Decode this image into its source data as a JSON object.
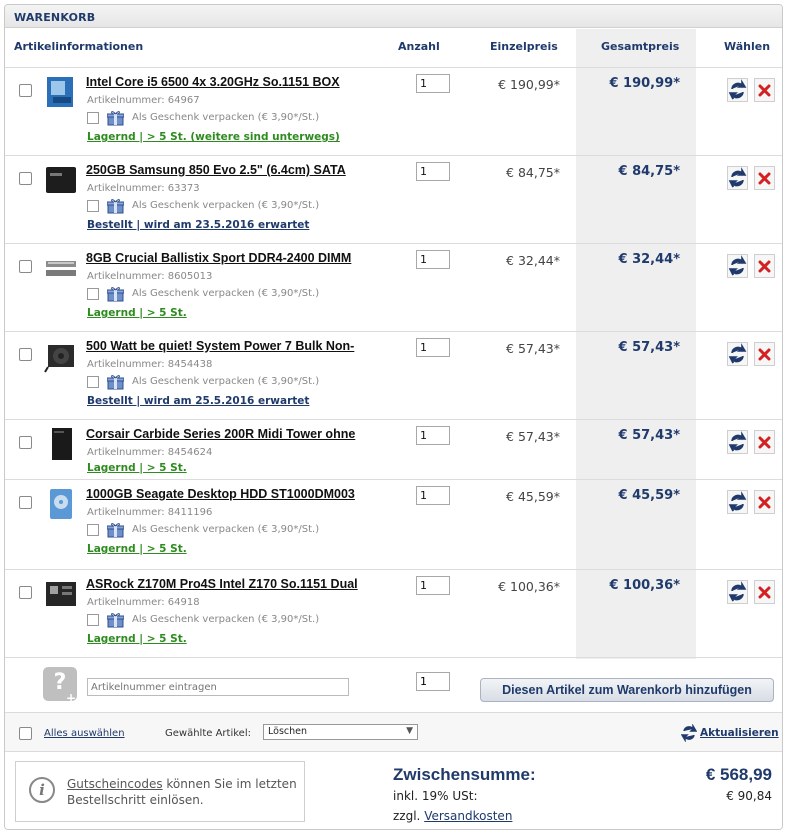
{
  "header": {
    "title": "WARENKORB"
  },
  "columns": {
    "info": "Artikelinformationen",
    "qty": "Anzahl",
    "unit": "Einzelpreis",
    "total": "Gesamtpreis",
    "select": "Wählen"
  },
  "gift_label": "Als Geschenk verpacken (€ 3,90*/St.)",
  "items": [
    {
      "title": "Intel Core i5 6500 4x 3.20GHz So.1151 BOX",
      "artnr": "Artikelnummer: 64967",
      "availability": "Lagernd | > 5 St. (weitere sind unterwegs)",
      "qty": "1",
      "unit_price": "€ 190,99*",
      "total_price": "€ 190,99*"
    },
    {
      "title": "250GB Samsung 850 Evo 2.5\" (6.4cm) SATA",
      "artnr": "Artikelnummer: 63373",
      "availability": "Bestellt | wird am 23.5.2016 erwartet",
      "qty": "1",
      "unit_price": "€ 84,75*",
      "total_price": "€ 84,75*"
    },
    {
      "title": "8GB Crucial Ballistix Sport DDR4-2400 DIMM",
      "artnr": "Artikelnummer: 8605013",
      "availability": "Lagernd | > 5 St.",
      "qty": "1",
      "unit_price": "€ 32,44*",
      "total_price": "€ 32,44*"
    },
    {
      "title": "500 Watt be quiet! System Power 7 Bulk Non-",
      "artnr": "Artikelnummer: 8454438",
      "availability": "Bestellt | wird am 25.5.2016 erwartet",
      "qty": "1",
      "unit_price": "€ 57,43*",
      "total_price": "€ 57,43*"
    },
    {
      "title": "Corsair Carbide Series 200R Midi Tower ohne",
      "artnr": "Artikelnummer: 8454624",
      "availability": "Lagernd | > 5 St.",
      "qty": "1",
      "unit_price": "€ 57,43*",
      "total_price": "€ 57,43*"
    },
    {
      "title": "1000GB Seagate Desktop HDD ST1000DM003",
      "artnr": "Artikelnummer: 8411196",
      "availability": "Lagernd | > 5 St.",
      "qty": "1",
      "unit_price": "€ 45,59*",
      "total_price": "€ 45,59*"
    },
    {
      "title": "ASRock Z170M Pro4S Intel Z170 So.1151 Dual",
      "artnr": "Artikelnummer: 64918",
      "availability": "Lagernd | > 5 St.",
      "qty": "1",
      "unit_price": "€ 100,36*",
      "total_price": "€ 100,36*"
    }
  ],
  "add_item": {
    "placeholder": "Artikelnummer eintragen",
    "qty": "1",
    "button": "Diesen Artikel zum Warenkorb hinzufügen"
  },
  "bulk": {
    "select_all": "Alles auswählen",
    "selected_label": "Gewählte Artikel:",
    "action": "Löschen",
    "refresh": "Aktualisieren"
  },
  "coupon": {
    "link": "Gutscheincodes",
    "text": " können Sie im letzten Bestellschritt einlösen."
  },
  "totals": {
    "subtotal_label": "Zwischensumme:",
    "subtotal": "€ 568,99",
    "vat_label": "inkl. 19% USt:",
    "vat": "€ 90,84",
    "shipping_prefix": "zzgl. ",
    "shipping_link": "Versandkosten"
  },
  "colors": {
    "brand_blue": "#1f3a6b",
    "stock_green": "#2e8b1f",
    "delete_red": "#d42020"
  }
}
